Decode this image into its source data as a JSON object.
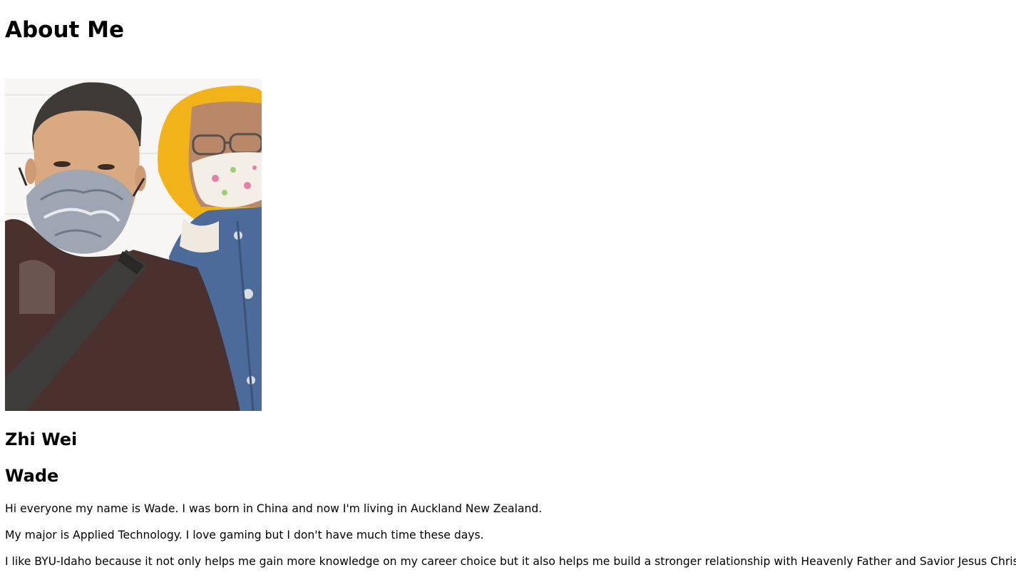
{
  "page": {
    "title": "About Me",
    "name_primary": "Zhi Wei",
    "name_secondary": "Wade",
    "paragraphs": [
      "Hi everyone my name is Wade. I was born in China and now I'm living in Auckland New Zealand.",
      "My major is Applied Technology. I love gaming but I don't have much time these days.",
      "I like BYU-Idaho because it not only helps me gain more knowledge on my career choice but it also helps me build a stronger relationship with Heavenly Father and Savior Jesus Christ."
    ]
  },
  "photo": {
    "subject": "selfie-two-people-masks"
  }
}
